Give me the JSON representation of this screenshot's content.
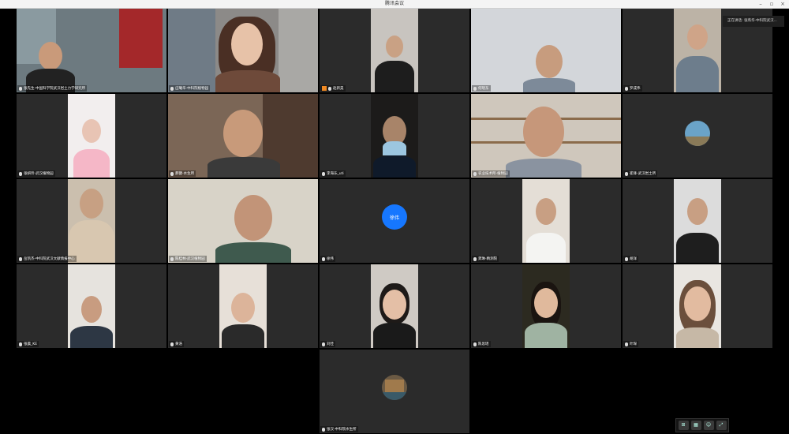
{
  "window": {
    "title": "腾讯会议"
  },
  "speaking_indicator": "正在讲话: 张燕华-中科院武汉...",
  "tiles": [
    {
      "name": "张先生-中国科学院武汉岩土力学研究所"
    },
    {
      "name": "庄曦华-中科院植物园"
    },
    {
      "name": "赵新昊"
    },
    {
      "name": "何晓东"
    },
    {
      "name": "罗成伟"
    },
    {
      "name": "张妍玲-武汉植物园"
    },
    {
      "name": "郝健-水生所"
    },
    {
      "name": "李海乐_uti"
    },
    {
      "name": "农业技术所-植物园"
    },
    {
      "name": "崔锋-武汉岩土所"
    },
    {
      "name": "岳凯杰-中科院武汉文献情报中心"
    },
    {
      "name": "陈桂林-武汉植物园"
    },
    {
      "name": "徐伟"
    },
    {
      "name": "龚琳-精测院"
    },
    {
      "name": "胡洋"
    },
    {
      "name": "张晨_KE"
    },
    {
      "name": "黄浩"
    },
    {
      "name": "刘佳"
    },
    {
      "name": "陈思瑶"
    },
    {
      "name": "叶琛"
    },
    {
      "name": "张汉-中科院水生所"
    }
  ],
  "blue_avatar_text": "徐伟"
}
